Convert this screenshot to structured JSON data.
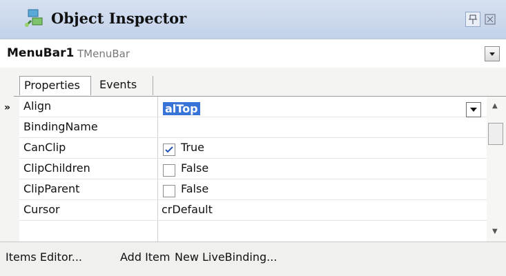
{
  "window": {
    "title": "Object Inspector"
  },
  "selector": {
    "name": "MenuBar1",
    "type": "TMenuBar"
  },
  "tabs": [
    {
      "label": "Properties"
    },
    {
      "label": "Events"
    }
  ],
  "grid": {
    "rows": [
      {
        "name": "Align",
        "value": "alTop",
        "selected": true
      },
      {
        "name": "BindingName",
        "value": ""
      },
      {
        "name": "CanClip",
        "value": "True",
        "checked": true
      },
      {
        "name": "ClipChildren",
        "value": "False",
        "checked": false
      },
      {
        "name": "ClipParent",
        "value": "False",
        "checked": false
      },
      {
        "name": "Cursor",
        "value": "crDefault"
      }
    ]
  },
  "footer": {
    "items": [
      "Items Editor...",
      "Add Item",
      "New LiveBinding..."
    ]
  }
}
